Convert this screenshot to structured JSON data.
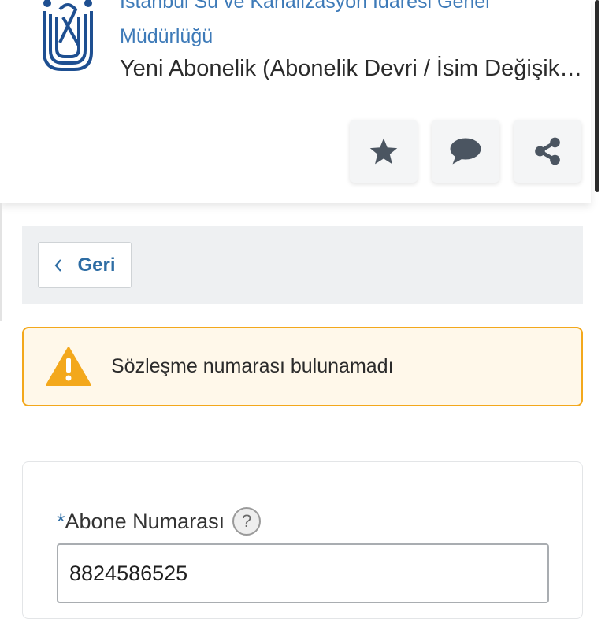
{
  "header": {
    "agency_line1": "İstanbul Su ve Kanalizasyon İdaresi Genel",
    "agency_line2": "Müdürlüğü",
    "service_title": "Yeni Abonelik (Abonelik Devri / İsim Değişikliği)",
    "actions": [
      {
        "name": "favorite",
        "icon": "star-icon"
      },
      {
        "name": "comment",
        "icon": "comment-icon"
      },
      {
        "name": "share",
        "icon": "share-icon"
      }
    ]
  },
  "nav": {
    "back_label": "Geri",
    "back_icon": "chevron-left-icon"
  },
  "alert": {
    "icon": "warning-icon",
    "message": "Sözleşme numarası bulunamadı",
    "color": "#f3a81c"
  },
  "form": {
    "required_mark": "*",
    "subscriber_label": "Abone Numarası",
    "help_mark": "?",
    "subscriber_value": "8824586525"
  },
  "colors": {
    "accent": "#2e6da4",
    "warning": "#f3a81c",
    "agency_text": "#3d7ab8"
  }
}
